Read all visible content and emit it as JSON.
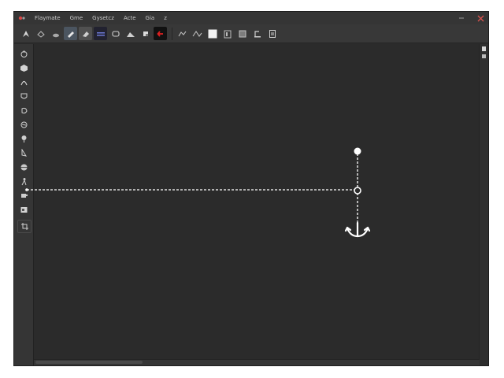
{
  "menu": [
    "Flaymate",
    "Gme",
    "Gysetcz",
    "Acte",
    "Gia",
    "z"
  ],
  "toolbar": {
    "buttons": [
      "select-tool-icon",
      "fill-icon",
      "cloud-icon",
      "brush-icon",
      "eraser-icon",
      "layers-icon",
      "chat-bubble-icon",
      "mountain-icon",
      "stamp-icon",
      "arrow-left-icon",
      "transform-icon",
      "warp-icon",
      "white-swatch-icon",
      "filter-icon",
      "adjust-icon",
      "export-icon",
      "document-icon"
    ]
  },
  "left_tools": [
    "move-tool-icon",
    "cube-tool-icon",
    "arc-tool-icon",
    "shield-tool-icon",
    "lasso-tool-icon",
    "rotate-tool-icon",
    "pin-tool-icon",
    "pen-tool-icon",
    "globe-tool-icon",
    "figure-tool-icon",
    "clone-tool-icon",
    "picture-tool-icon",
    "crop-tool-icon"
  ],
  "colors": {
    "canvas": "#2b2b2b",
    "panel": "#353535",
    "guide": "#ffffff",
    "close": "#d9534f",
    "accent_red": "#e02020"
  }
}
